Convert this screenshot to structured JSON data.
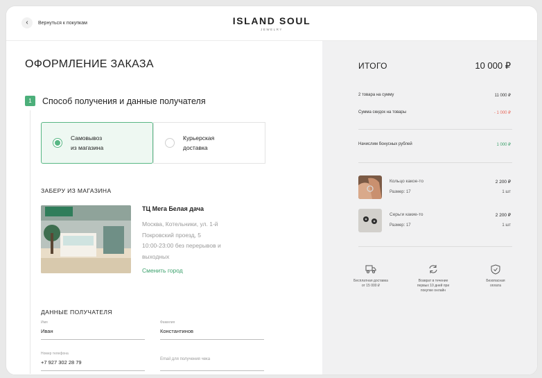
{
  "header": {
    "back_label": "Вернуться к покупкам",
    "brand_name": "ISLAND SOUL",
    "brand_sub": "JEWELRY"
  },
  "checkout": {
    "title": "ОФОРМЛЕНИЕ ЗАКАЗА",
    "step_number": "1",
    "step_label": "Способ получения и данные получателя",
    "options": [
      {
        "line1": "Самовывоз",
        "line2": "из магазина",
        "selected": true
      },
      {
        "line1": "Курьерская",
        "line2": "доставка",
        "selected": false
      }
    ],
    "pickup_title": "ЗАБЕРУ ИЗ МАГАЗИНА",
    "store": {
      "name": "ТЦ Мега Белая дача",
      "address_lines": [
        "Москва, Котельники, ул. 1-й",
        "Покровский проезд, 5",
        "10:00-23:00 без перерывов и",
        "выходных"
      ],
      "change_label": "Сменить город"
    },
    "recipient_title": "ДАННЫЕ ПОЛУЧАТЕЛЯ",
    "fields": {
      "name_label": "Имя",
      "name_value": "Иван",
      "surname_label": "Фамилия",
      "surname_value": "Константинов",
      "phone_label": "Номер телефона",
      "phone_value": "+7 927 302 28 79",
      "email_placeholder": "Email для получения чека"
    }
  },
  "summary": {
    "title": "ИТОГО",
    "total": "10 000 ₽",
    "lines": [
      {
        "label": "2 товара на сумму",
        "value": "11 000 ₽"
      },
      {
        "label": "Сумма скидок на товары",
        "value": "- 1 000 ₽"
      }
    ],
    "bonus": {
      "label": "Начислим бонусных рублей",
      "value": "1 000 ₽"
    },
    "products": [
      {
        "name": "Кольцо какое-то",
        "size": "Размер: 17",
        "price": "2 200 ₽",
        "qty": "1 шт"
      },
      {
        "name": "Серьги какие-то",
        "size": "Размер: 17",
        "price": "2 200 ₽",
        "qty": "1 шт"
      }
    ],
    "benefits": [
      {
        "icon": "truck-icon",
        "line1": "Бесплатная доставка",
        "line2": "от 15 000 ₽",
        "line3": ""
      },
      {
        "icon": "return-icon",
        "line1": "Возврат в течение",
        "line2": "первых 10 дней при",
        "line3": "покупке онлайн"
      },
      {
        "icon": "shield-check-icon",
        "line1": "Безопасная",
        "line2": "оплата",
        "line3": ""
      }
    ],
    "colors": {
      "accent": "#4caf7a",
      "discount": "#e8685a",
      "bonus": "#3aa06b"
    }
  }
}
